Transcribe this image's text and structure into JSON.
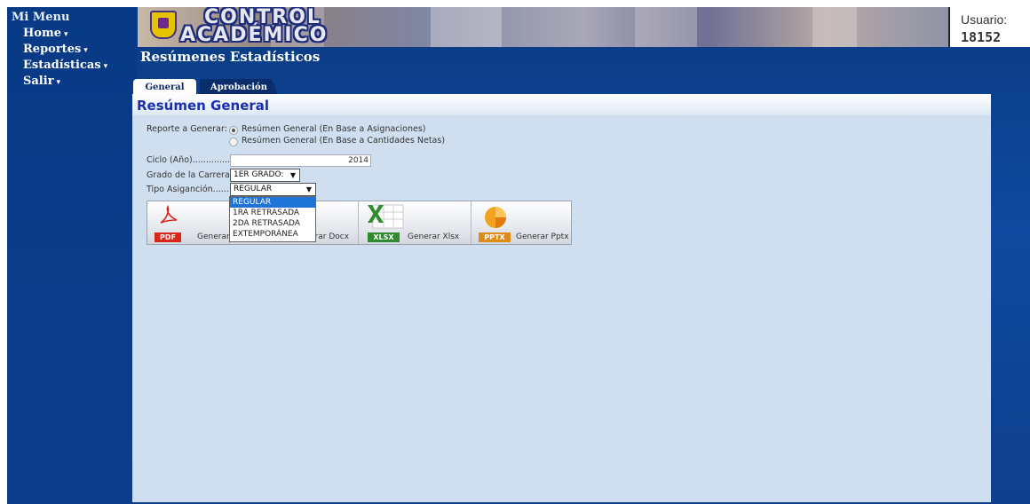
{
  "menu": {
    "title": "Mi Menu",
    "items": [
      {
        "label": "Home"
      },
      {
        "label": "Reportes"
      },
      {
        "label": "Estadísticas"
      },
      {
        "label": "Salir"
      }
    ]
  },
  "banner": {
    "line1": "CONTROL",
    "line2": "ACADÉMICO"
  },
  "user": {
    "label": "Usuario:",
    "id": "18152"
  },
  "page_title": "Resúmenes Estadísticos",
  "tabs": [
    {
      "label": "General",
      "active": true
    },
    {
      "label": "Aprobación",
      "active": false
    }
  ],
  "panel": {
    "title": "Resúmen General",
    "report_label": "Reporte a Generar:",
    "report_options": [
      {
        "label": "Resúmen General (En Base a Asignaciones)",
        "checked": true
      },
      {
        "label": "Resúmen General (En Base a Cantidades Netas)",
        "checked": false
      }
    ],
    "cycle_label": "Ciclo (Año)..............:",
    "cycle_value": "2014",
    "grade_label": "Grado de la Carrera:",
    "grade_value": "1ER GRADO:",
    "type_label": "Tipo Asiganción......:",
    "type_value": "REGULAR",
    "type_options": [
      "REGULAR",
      "1RA RETRASADA",
      "2DA RETRASADA",
      "EXTEMPORÁNEA"
    ]
  },
  "toolbar": {
    "pdf_tag": "PDF",
    "pdf_label": "Generar",
    "docx_label": "erar Docx",
    "xlsx_tag": "XLSX",
    "xlsx_label": "Generar Xlsx",
    "pptx_tag": "PPTX",
    "pptx_label": "Generar Pptx"
  },
  "colors": {
    "frame": "#0f4aa0",
    "panel": "#cfdff0",
    "title_blue": "#1a2fb0",
    "selected": "#1e73d6",
    "pdf": "#d9261c",
    "xlsx": "#2e8b2e",
    "pptx": "#e08a1a"
  }
}
